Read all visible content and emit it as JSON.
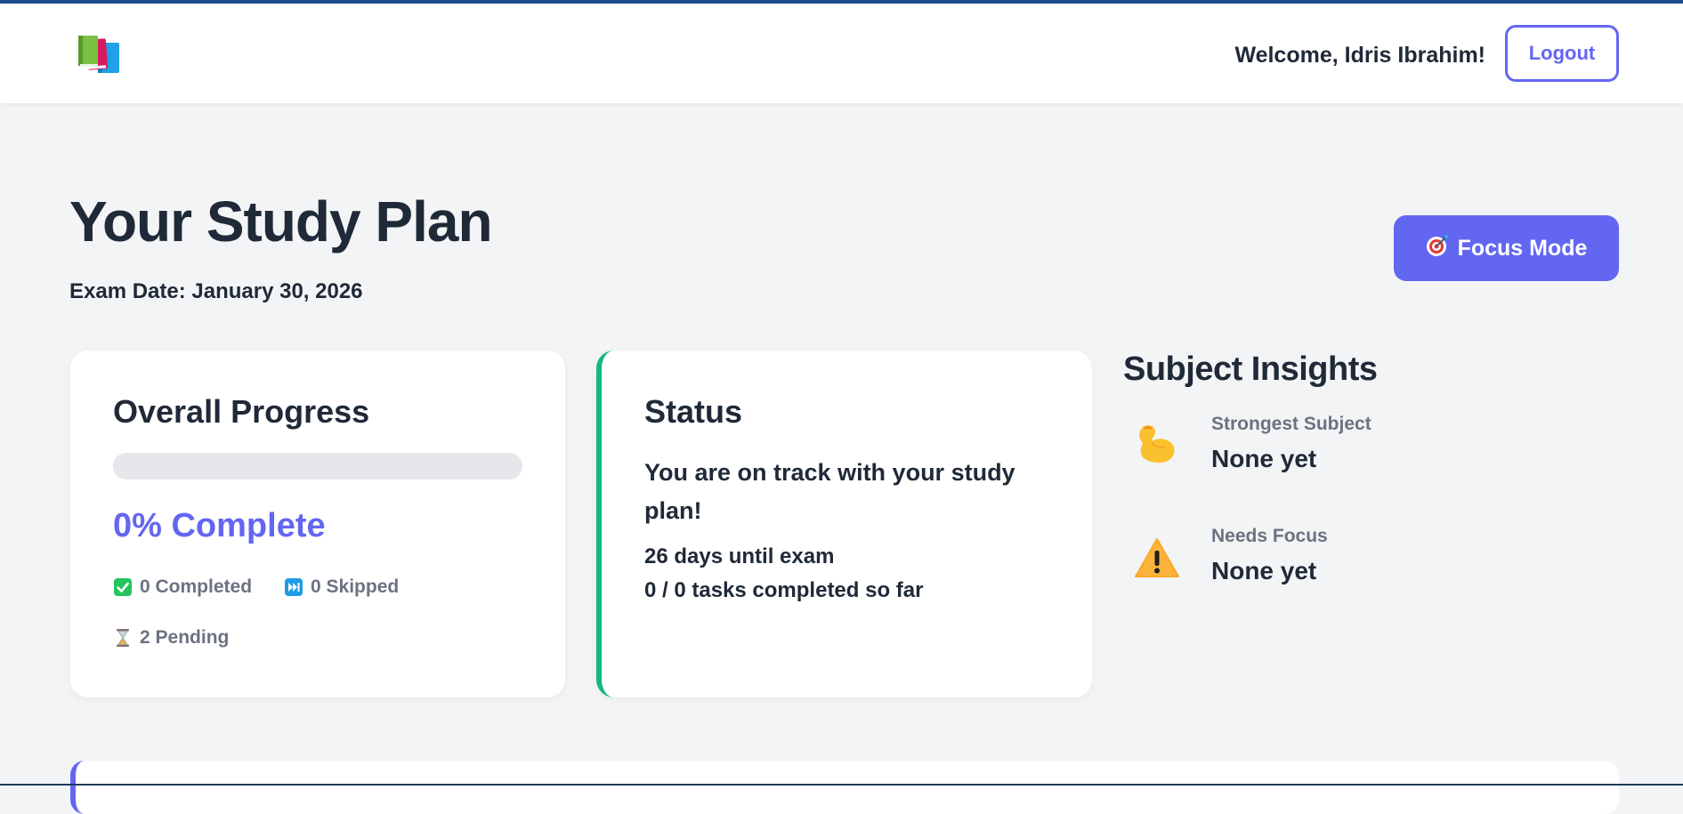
{
  "header": {
    "welcome_text": "Welcome, Idris Ibrahim!",
    "logout_label": "Logout"
  },
  "page": {
    "title": "Your Study Plan",
    "exam_date": "Exam Date: January 30, 2026",
    "focus_mode_label": "Focus Mode"
  },
  "progress": {
    "title": "Overall Progress",
    "fraction": 0,
    "percent_label": "0% Complete",
    "completed_label": "0 Completed",
    "skipped_label": "0 Skipped",
    "pending_label": "2 Pending"
  },
  "status": {
    "title": "Status",
    "message": "You are on track with your study plan!",
    "days_until_exam": "26 days until exam",
    "tasks_completed": "0 / 0 tasks completed so far"
  },
  "insights": {
    "title": "Subject Insights",
    "strongest_label": "Strongest Subject",
    "strongest_value": "None yet",
    "needs_focus_label": "Needs Focus",
    "needs_focus_value": "None yet"
  },
  "colors": {
    "accent": "#6366f1",
    "status_border": "#10b981",
    "header_line": "#1e4f8f"
  },
  "icons": {
    "logo": "books-icon",
    "focus": "target-icon",
    "completed": "check-icon",
    "skipped": "fast-forward-icon",
    "pending": "hourglass-icon",
    "strongest": "flexed-biceps-icon",
    "needs_focus": "warning-icon"
  }
}
